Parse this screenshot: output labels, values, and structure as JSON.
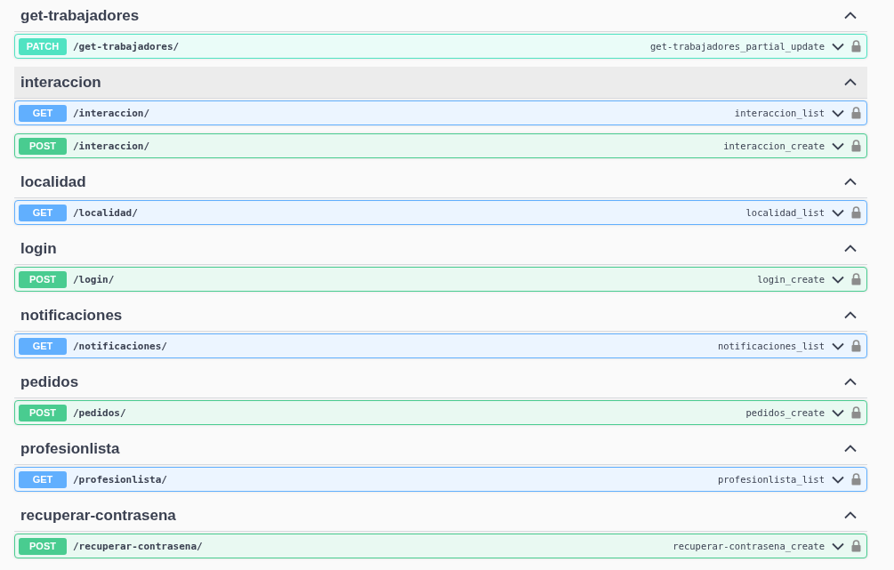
{
  "tags": [
    {
      "name": "get-trabajadores",
      "expanded": true,
      "highlighted": false,
      "operations": [
        {
          "method": "PATCH",
          "color": "#50e3c2",
          "path": "/get-trabajadores/",
          "operation_id": "get-trabajadores_partial_update",
          "expanded": false
        }
      ]
    },
    {
      "name": "interaccion",
      "expanded": true,
      "highlighted": true,
      "operations": [
        {
          "method": "GET",
          "color": "#61affe",
          "path": "/interaccion/",
          "operation_id": "interaccion_list",
          "expanded": false
        },
        {
          "method": "POST",
          "color": "#49cc90",
          "path": "/interaccion/",
          "operation_id": "interaccion_create",
          "expanded": false
        }
      ]
    },
    {
      "name": "localidad",
      "expanded": true,
      "highlighted": false,
      "operations": [
        {
          "method": "GET",
          "color": "#61affe",
          "path": "/localidad/",
          "operation_id": "localidad_list",
          "expanded": false
        }
      ]
    },
    {
      "name": "login",
      "expanded": true,
      "highlighted": false,
      "operations": [
        {
          "method": "POST",
          "color": "#49cc90",
          "path": "/login/",
          "operation_id": "login_create",
          "expanded": false
        }
      ]
    },
    {
      "name": "notificaciones",
      "expanded": true,
      "highlighted": false,
      "operations": [
        {
          "method": "GET",
          "color": "#61affe",
          "path": "/notificaciones/",
          "operation_id": "notificaciones_list",
          "expanded": false
        }
      ]
    },
    {
      "name": "pedidos",
      "expanded": true,
      "highlighted": false,
      "operations": [
        {
          "method": "POST",
          "color": "#49cc90",
          "path": "/pedidos/",
          "operation_id": "pedidos_create",
          "expanded": false
        }
      ]
    },
    {
      "name": "profesionlista",
      "expanded": true,
      "highlighted": false,
      "operations": [
        {
          "method": "GET",
          "color": "#61affe",
          "path": "/profesionlista/",
          "operation_id": "profesionlista_list",
          "expanded": false
        }
      ]
    },
    {
      "name": "recuperar-contrasena",
      "expanded": true,
      "highlighted": false,
      "operations": [
        {
          "method": "POST",
          "color": "#49cc90",
          "path": "/recuperar-contrasena/",
          "operation_id": "recuperar-contrasena_create",
          "expanded": false
        }
      ]
    }
  ]
}
